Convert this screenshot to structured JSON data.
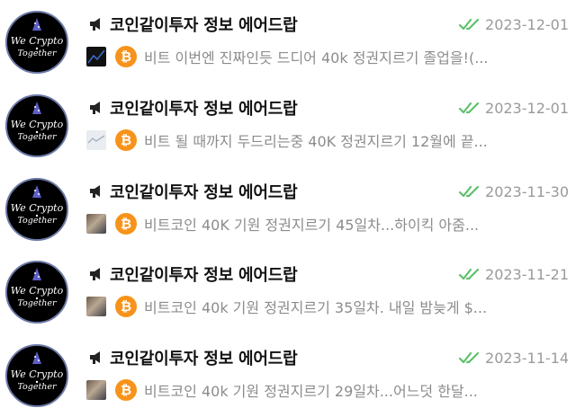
{
  "avatar_text": "We Crypto Together",
  "colors": {
    "bitcoin": "#f7931a",
    "check": "#5cc16a",
    "date": "#9a9a9a",
    "preview": "#8c8c8c"
  },
  "icons": {
    "announce": "megaphone-icon",
    "read": "double-check-icon",
    "coin": "bitcoin-icon",
    "bitcoin_symbol": "₿"
  },
  "chats": [
    {
      "title": "코인같이투자 정보 에어드랍",
      "date": "2023-12-01",
      "preview": "비트 이번엔 진짜인듯  드디어 40k 정권지르기 졸업을!(...",
      "thumb": "dark"
    },
    {
      "title": "코인같이투자 정보 에어드랍",
      "date": "2023-12-01",
      "preview": "비트 될 때까지 두드리는중 40K 정권지르기  12월에 끝...",
      "thumb": "light"
    },
    {
      "title": "코인같이투자 정보 에어드랍",
      "date": "2023-11-30",
      "preview": "비트코인 40K 기원 정권지르기  45일차...하이킥 아줌...",
      "thumb": "photo"
    },
    {
      "title": "코인같이투자 정보 에어드랍",
      "date": "2023-11-21",
      "preview": "비트코인 40k 기원 정권지르기  35일차. 내일 밤늦게 $...",
      "thumb": "photo"
    },
    {
      "title": "코인같이투자 정보 에어드랍",
      "date": "2023-11-14",
      "preview": "비트코인 40k 기원 정권지르기   29일차...어느덧 한달...",
      "thumb": "photo"
    }
  ]
}
